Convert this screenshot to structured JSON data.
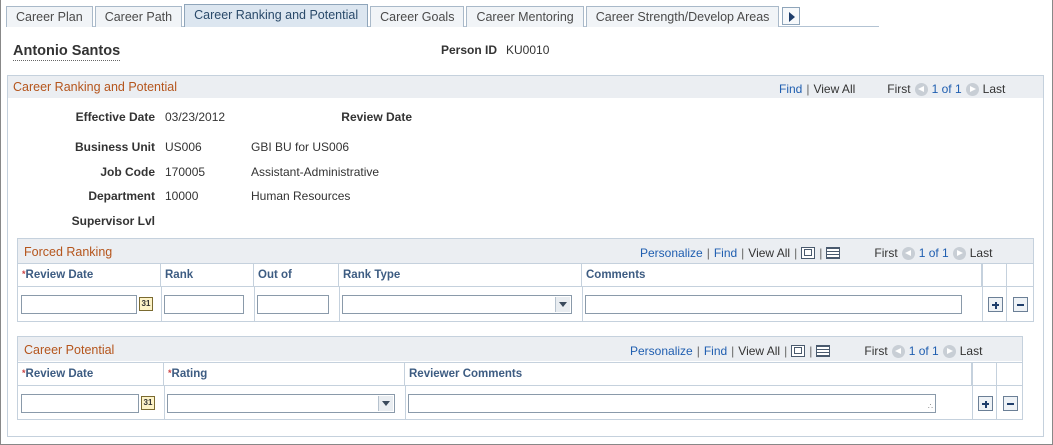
{
  "tabs": [
    {
      "label": "Career Plan"
    },
    {
      "label": "Career Path"
    },
    {
      "label": "Career Ranking and Potential"
    },
    {
      "label": "Career Goals"
    },
    {
      "label": "Career Mentoring"
    },
    {
      "label": "Career Strength/Develop Areas"
    }
  ],
  "person": {
    "name": "Antonio Santos",
    "id_label": "Person ID",
    "id_value": "KU0010"
  },
  "main": {
    "title": "Career Ranking and Potential",
    "nav": {
      "find": "Find",
      "view_all": "View All",
      "first": "First",
      "count": "1 of 1",
      "last": "Last"
    },
    "fields": {
      "effective_date_label": "Effective Date",
      "effective_date_value": "03/23/2012",
      "review_date_label": "Review Date",
      "business_unit_label": "Business Unit",
      "business_unit_value": "US006",
      "business_unit_desc": "GBI BU for US006",
      "job_code_label": "Job Code",
      "job_code_value": "170005",
      "job_code_desc": "Assistant-Administrative",
      "department_label": "Department",
      "department_value": "10000",
      "department_desc": "Human Resources",
      "supervisor_label": "Supervisor Lvl"
    }
  },
  "forced_ranking": {
    "title": "Forced Ranking",
    "nav": {
      "personalize": "Personalize",
      "find": "Find",
      "view_all": "View All",
      "first": "First",
      "count": "1 of 1",
      "last": "Last"
    },
    "columns": {
      "review_date": "Review Date",
      "rank": "Rank",
      "out_of": "Out of",
      "rank_type": "Rank Type",
      "comments": "Comments"
    },
    "row": {
      "review_date": "",
      "rank": "",
      "out_of": "",
      "rank_type": "",
      "comments": ""
    }
  },
  "career_potential": {
    "title": "Career Potential",
    "nav": {
      "personalize": "Personalize",
      "find": "Find",
      "view_all": "View All",
      "first": "First",
      "count": "1 of 1",
      "last": "Last"
    },
    "columns": {
      "review_date": "Review Date",
      "rating": "Rating",
      "reviewer_comments": "Reviewer Comments"
    },
    "row": {
      "review_date": "",
      "rating": "",
      "reviewer_comments": ""
    }
  },
  "icons": {
    "calendar": "calendar-icon",
    "dropdown": "chevron-down-icon",
    "add_row": "plus-icon",
    "delete_row": "minus-icon",
    "zoom": "zoom-icon",
    "download": "grid-download-icon",
    "prev": "arrow-left-icon",
    "next": "arrow-right-icon"
  },
  "colors": {
    "section_title": "#b5551c",
    "link": "#1f5eb0",
    "column_header": "#3d5c82",
    "header_bg": "#ebeef2"
  }
}
